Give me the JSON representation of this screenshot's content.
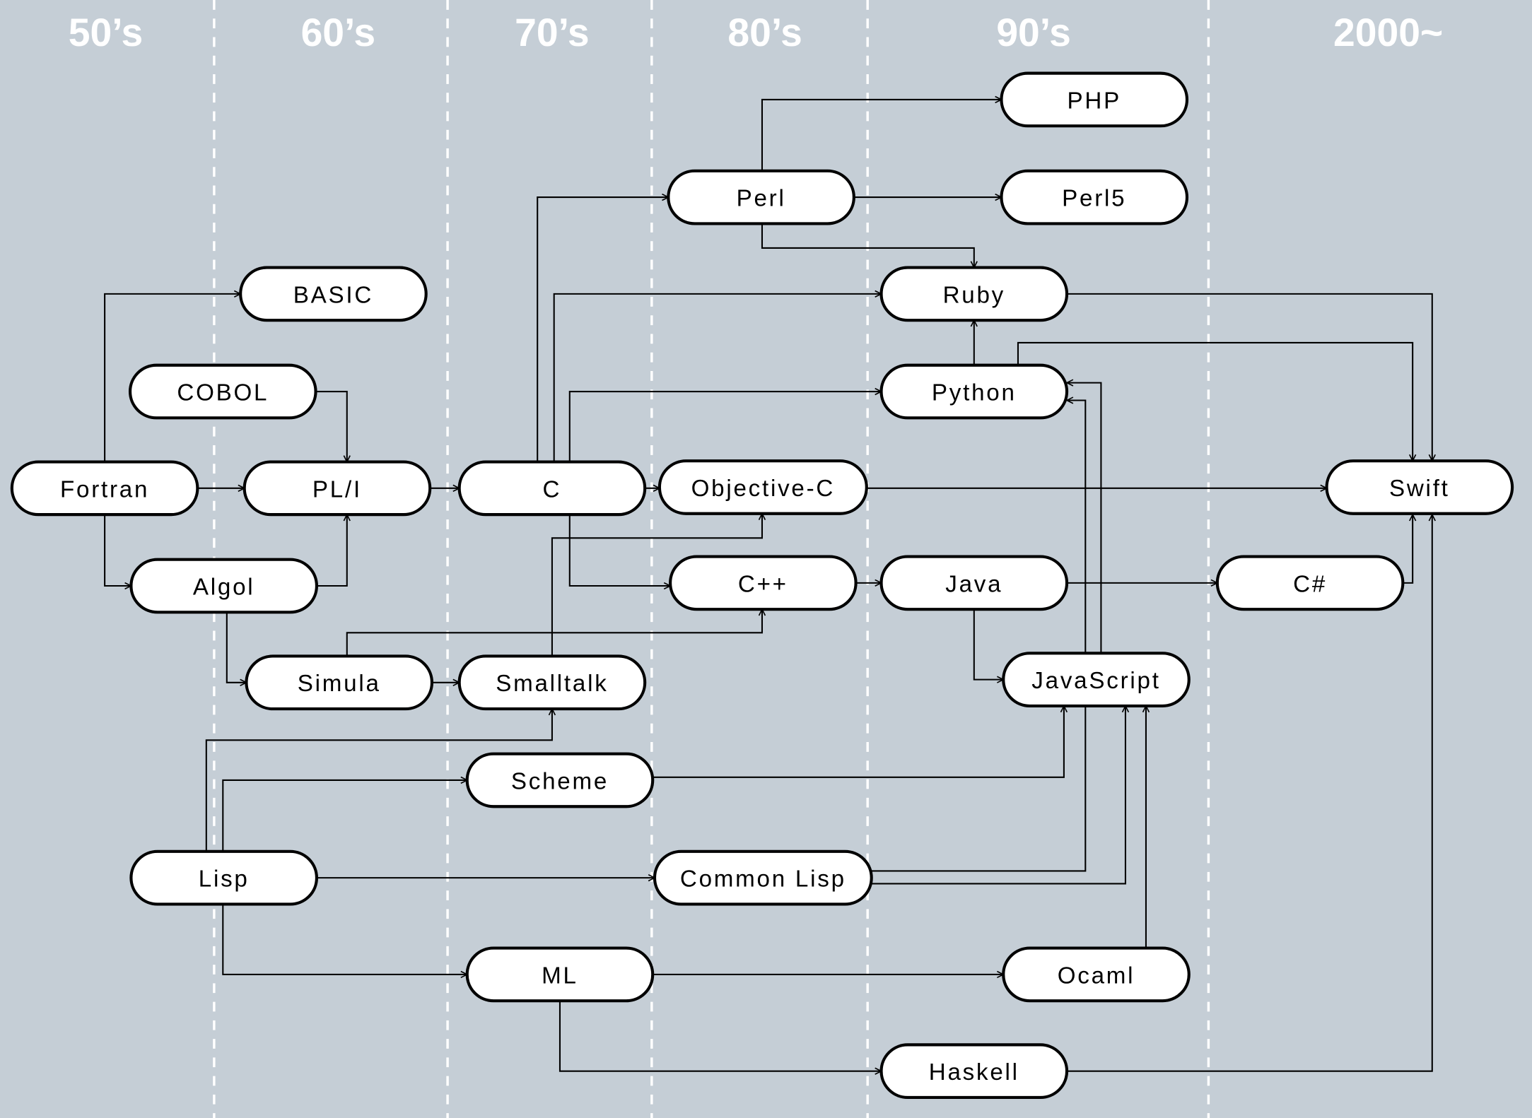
{
  "colors": {
    "background": "#c5ced6",
    "divider": "#ffffff",
    "era_label": "#ffffff",
    "node_fill": "#ffffff",
    "stroke": "#000000"
  },
  "eras": [
    "50’s",
    "60’s",
    "70’s",
    "80’s",
    "90’s",
    "2000~"
  ],
  "nodes": [
    {
      "id": "fortran",
      "label": "Fortran"
    },
    {
      "id": "basic",
      "label": "BASIC"
    },
    {
      "id": "cobol",
      "label": "COBOL"
    },
    {
      "id": "pli",
      "label": "PL/I"
    },
    {
      "id": "algol",
      "label": "Algol"
    },
    {
      "id": "simula",
      "label": "Simula"
    },
    {
      "id": "smalltalk",
      "label": "Smalltalk"
    },
    {
      "id": "c",
      "label": "C"
    },
    {
      "id": "objc",
      "label": "Objective-C"
    },
    {
      "id": "cpp",
      "label": "C++"
    },
    {
      "id": "perl",
      "label": "Perl"
    },
    {
      "id": "php",
      "label": "PHP"
    },
    {
      "id": "perl5",
      "label": "Perl5"
    },
    {
      "id": "ruby",
      "label": "Ruby"
    },
    {
      "id": "python",
      "label": "Python"
    },
    {
      "id": "java",
      "label": "Java"
    },
    {
      "id": "javascript",
      "label": "JavaScript"
    },
    {
      "id": "csharp",
      "label": "C#"
    },
    {
      "id": "swift",
      "label": "Swift"
    },
    {
      "id": "scheme",
      "label": "Scheme"
    },
    {
      "id": "lisp",
      "label": "Lisp"
    },
    {
      "id": "commonlisp",
      "label": "Common Lisp"
    },
    {
      "id": "ml",
      "label": "ML"
    },
    {
      "id": "ocaml",
      "label": "Ocaml"
    },
    {
      "id": "haskell",
      "label": "Haskell"
    }
  ],
  "edges": [
    {
      "from": "fortran",
      "to": "basic"
    },
    {
      "from": "fortran",
      "to": "pli"
    },
    {
      "from": "fortran",
      "to": "algol"
    },
    {
      "from": "cobol",
      "to": "pli"
    },
    {
      "from": "algol",
      "to": "pli"
    },
    {
      "from": "algol",
      "to": "simula"
    },
    {
      "from": "pli",
      "to": "c"
    },
    {
      "from": "simula",
      "to": "smalltalk"
    },
    {
      "from": "simula",
      "to": "cpp"
    },
    {
      "from": "smalltalk",
      "to": "objc"
    },
    {
      "from": "c",
      "to": "perl"
    },
    {
      "from": "c",
      "to": "ruby"
    },
    {
      "from": "c",
      "to": "python"
    },
    {
      "from": "c",
      "to": "objc"
    },
    {
      "from": "c",
      "to": "cpp"
    },
    {
      "from": "perl",
      "to": "php"
    },
    {
      "from": "perl",
      "to": "perl5"
    },
    {
      "from": "perl",
      "to": "ruby"
    },
    {
      "from": "python",
      "to": "ruby"
    },
    {
      "from": "ruby",
      "to": "swift"
    },
    {
      "from": "python",
      "to": "swift"
    },
    {
      "from": "objc",
      "to": "swift"
    },
    {
      "from": "cpp",
      "to": "java"
    },
    {
      "from": "java",
      "to": "csharp"
    },
    {
      "from": "csharp",
      "to": "swift"
    },
    {
      "from": "java",
      "to": "javascript"
    },
    {
      "from": "javascript",
      "to": "python"
    },
    {
      "from": "commonlisp",
      "to": "python"
    },
    {
      "from": "commonlisp",
      "to": "javascript"
    },
    {
      "from": "scheme",
      "to": "javascript"
    },
    {
      "from": "ocaml",
      "to": "javascript"
    },
    {
      "from": "lisp",
      "to": "smalltalk"
    },
    {
      "from": "lisp",
      "to": "scheme"
    },
    {
      "from": "lisp",
      "to": "commonlisp"
    },
    {
      "from": "lisp",
      "to": "ml"
    },
    {
      "from": "ml",
      "to": "ocaml"
    },
    {
      "from": "ml",
      "to": "haskell"
    },
    {
      "from": "haskell",
      "to": "swift"
    }
  ]
}
